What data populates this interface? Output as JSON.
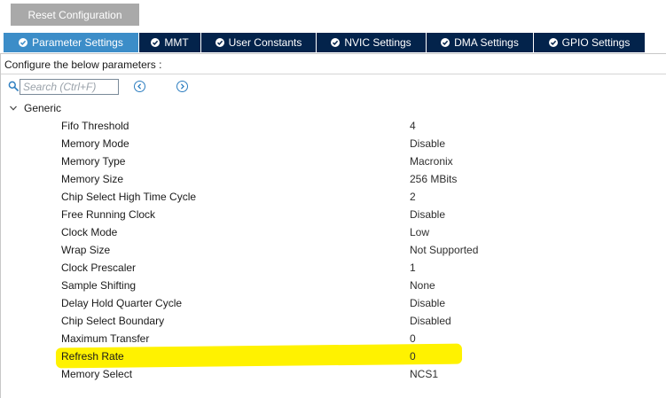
{
  "toolbar": {
    "reset_label": "Reset Configuration"
  },
  "tabs": [
    {
      "label": "Parameter Settings",
      "active": true
    },
    {
      "label": "MMT",
      "active": false
    },
    {
      "label": "User Constants",
      "active": false
    },
    {
      "label": "NVIC Settings",
      "active": false
    },
    {
      "label": "DMA Settings",
      "active": false
    },
    {
      "label": "GPIO Settings",
      "active": false
    }
  ],
  "panel": {
    "configure_label": "Configure the below parameters :"
  },
  "search": {
    "placeholder": "Search (Ctrl+F)",
    "value": ""
  },
  "group": {
    "label": "Generic",
    "expanded": true
  },
  "parameters": [
    {
      "name": "Fifo Threshold",
      "value": "4"
    },
    {
      "name": "Memory Mode",
      "value": "Disable"
    },
    {
      "name": "Memory Type",
      "value": "Macronix"
    },
    {
      "name": "Memory Size",
      "value": "256 MBits"
    },
    {
      "name": "Chip Select High Time Cycle",
      "value": "2"
    },
    {
      "name": "Free Running Clock",
      "value": "Disable"
    },
    {
      "name": "Clock Mode",
      "value": "Low"
    },
    {
      "name": "Wrap Size",
      "value": "Not Supported"
    },
    {
      "name": "Clock Prescaler",
      "value": "1"
    },
    {
      "name": "Sample Shifting",
      "value": "None"
    },
    {
      "name": "Delay Hold Quarter Cycle",
      "value": "Disable"
    },
    {
      "name": "Chip Select Boundary",
      "value": "Disabled"
    },
    {
      "name": "Maximum Transfer",
      "value": "0"
    },
    {
      "name": "Refresh Rate",
      "value": "0"
    },
    {
      "name": "Memory Select",
      "value": "NCS1"
    }
  ],
  "icons": {
    "tab": "check-circle-icon",
    "search": "search-icon",
    "prev": "chevron-left-circle-icon",
    "next": "chevron-right-circle-icon",
    "group_toggle": "chevron-down-icon"
  },
  "colors": {
    "tab_bar": "#03234b",
    "tab_active": "#3c8dc8",
    "reset_button": "#a9a9a9",
    "highlight": "#fff200",
    "accent": "#2d7ec0"
  }
}
